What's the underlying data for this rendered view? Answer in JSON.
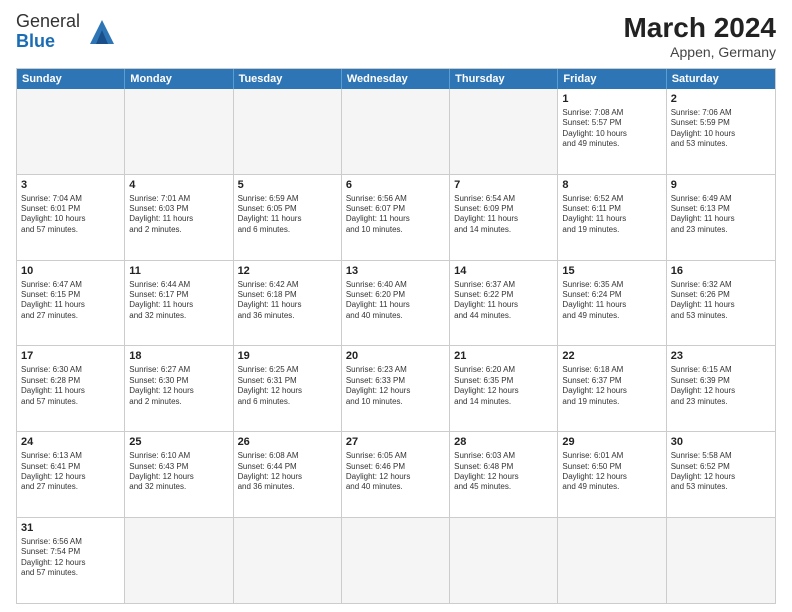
{
  "header": {
    "logo_general": "General",
    "logo_blue": "Blue",
    "month_year": "March 2024",
    "location": "Appen, Germany"
  },
  "weekdays": [
    "Sunday",
    "Monday",
    "Tuesday",
    "Wednesday",
    "Thursday",
    "Friday",
    "Saturday"
  ],
  "rows": [
    [
      {
        "day": "",
        "info": ""
      },
      {
        "day": "",
        "info": ""
      },
      {
        "day": "",
        "info": ""
      },
      {
        "day": "",
        "info": ""
      },
      {
        "day": "",
        "info": ""
      },
      {
        "day": "1",
        "info": "Sunrise: 7:08 AM\nSunset: 5:57 PM\nDaylight: 10 hours\nand 49 minutes."
      },
      {
        "day": "2",
        "info": "Sunrise: 7:06 AM\nSunset: 5:59 PM\nDaylight: 10 hours\nand 53 minutes."
      }
    ],
    [
      {
        "day": "3",
        "info": "Sunrise: 7:04 AM\nSunset: 6:01 PM\nDaylight: 10 hours\nand 57 minutes."
      },
      {
        "day": "4",
        "info": "Sunrise: 7:01 AM\nSunset: 6:03 PM\nDaylight: 11 hours\nand 2 minutes."
      },
      {
        "day": "5",
        "info": "Sunrise: 6:59 AM\nSunset: 6:05 PM\nDaylight: 11 hours\nand 6 minutes."
      },
      {
        "day": "6",
        "info": "Sunrise: 6:56 AM\nSunset: 6:07 PM\nDaylight: 11 hours\nand 10 minutes."
      },
      {
        "day": "7",
        "info": "Sunrise: 6:54 AM\nSunset: 6:09 PM\nDaylight: 11 hours\nand 14 minutes."
      },
      {
        "day": "8",
        "info": "Sunrise: 6:52 AM\nSunset: 6:11 PM\nDaylight: 11 hours\nand 19 minutes."
      },
      {
        "day": "9",
        "info": "Sunrise: 6:49 AM\nSunset: 6:13 PM\nDaylight: 11 hours\nand 23 minutes."
      }
    ],
    [
      {
        "day": "10",
        "info": "Sunrise: 6:47 AM\nSunset: 6:15 PM\nDaylight: 11 hours\nand 27 minutes."
      },
      {
        "day": "11",
        "info": "Sunrise: 6:44 AM\nSunset: 6:17 PM\nDaylight: 11 hours\nand 32 minutes."
      },
      {
        "day": "12",
        "info": "Sunrise: 6:42 AM\nSunset: 6:18 PM\nDaylight: 11 hours\nand 36 minutes."
      },
      {
        "day": "13",
        "info": "Sunrise: 6:40 AM\nSunset: 6:20 PM\nDaylight: 11 hours\nand 40 minutes."
      },
      {
        "day": "14",
        "info": "Sunrise: 6:37 AM\nSunset: 6:22 PM\nDaylight: 11 hours\nand 44 minutes."
      },
      {
        "day": "15",
        "info": "Sunrise: 6:35 AM\nSunset: 6:24 PM\nDaylight: 11 hours\nand 49 minutes."
      },
      {
        "day": "16",
        "info": "Sunrise: 6:32 AM\nSunset: 6:26 PM\nDaylight: 11 hours\nand 53 minutes."
      }
    ],
    [
      {
        "day": "17",
        "info": "Sunrise: 6:30 AM\nSunset: 6:28 PM\nDaylight: 11 hours\nand 57 minutes."
      },
      {
        "day": "18",
        "info": "Sunrise: 6:27 AM\nSunset: 6:30 PM\nDaylight: 12 hours\nand 2 minutes."
      },
      {
        "day": "19",
        "info": "Sunrise: 6:25 AM\nSunset: 6:31 PM\nDaylight: 12 hours\nand 6 minutes."
      },
      {
        "day": "20",
        "info": "Sunrise: 6:23 AM\nSunset: 6:33 PM\nDaylight: 12 hours\nand 10 minutes."
      },
      {
        "day": "21",
        "info": "Sunrise: 6:20 AM\nSunset: 6:35 PM\nDaylight: 12 hours\nand 14 minutes."
      },
      {
        "day": "22",
        "info": "Sunrise: 6:18 AM\nSunset: 6:37 PM\nDaylight: 12 hours\nand 19 minutes."
      },
      {
        "day": "23",
        "info": "Sunrise: 6:15 AM\nSunset: 6:39 PM\nDaylight: 12 hours\nand 23 minutes."
      }
    ],
    [
      {
        "day": "24",
        "info": "Sunrise: 6:13 AM\nSunset: 6:41 PM\nDaylight: 12 hours\nand 27 minutes."
      },
      {
        "day": "25",
        "info": "Sunrise: 6:10 AM\nSunset: 6:43 PM\nDaylight: 12 hours\nand 32 minutes."
      },
      {
        "day": "26",
        "info": "Sunrise: 6:08 AM\nSunset: 6:44 PM\nDaylight: 12 hours\nand 36 minutes."
      },
      {
        "day": "27",
        "info": "Sunrise: 6:05 AM\nSunset: 6:46 PM\nDaylight: 12 hours\nand 40 minutes."
      },
      {
        "day": "28",
        "info": "Sunrise: 6:03 AM\nSunset: 6:48 PM\nDaylight: 12 hours\nand 45 minutes."
      },
      {
        "day": "29",
        "info": "Sunrise: 6:01 AM\nSunset: 6:50 PM\nDaylight: 12 hours\nand 49 minutes."
      },
      {
        "day": "30",
        "info": "Sunrise: 5:58 AM\nSunset: 6:52 PM\nDaylight: 12 hours\nand 53 minutes."
      }
    ],
    [
      {
        "day": "31",
        "info": "Sunrise: 6:56 AM\nSunset: 7:54 PM\nDaylight: 12 hours\nand 57 minutes."
      },
      {
        "day": "",
        "info": ""
      },
      {
        "day": "",
        "info": ""
      },
      {
        "day": "",
        "info": ""
      },
      {
        "day": "",
        "info": ""
      },
      {
        "day": "",
        "info": ""
      },
      {
        "day": "",
        "info": ""
      }
    ]
  ]
}
